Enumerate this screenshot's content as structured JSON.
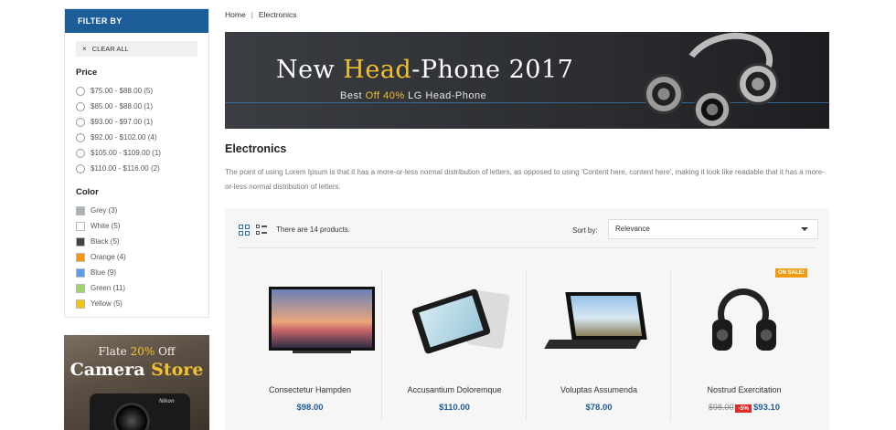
{
  "sidebar": {
    "filter_heading": "FILTER BY",
    "clear_all": "CLEAR ALL",
    "price_title": "Price",
    "prices": [
      "$75.00 - $88.00 (5)",
      "$85.00 - $88.00 (1)",
      "$93.00 - $97.00 (1)",
      "$92.00 - $102.00 (4)",
      "$105.00 - $109.00 (1)",
      "$110.00 - $116.00 (2)"
    ],
    "color_title": "Color",
    "colors": [
      {
        "label": "Grey (3)",
        "hex": "#aab0b8"
      },
      {
        "label": "White (5)",
        "hex": "#ffffff"
      },
      {
        "label": "Black (5)",
        "hex": "#434343"
      },
      {
        "label": "Orange (4)",
        "hex": "#f39c11"
      },
      {
        "label": "Blue (9)",
        "hex": "#5d9cec"
      },
      {
        "label": "Green (11)",
        "hex": "#a0d468"
      },
      {
        "label": "Yellow (5)",
        "hex": "#f1c40f"
      }
    ],
    "promo": {
      "pre": "Flate ",
      "pct": "20%",
      "post": " Off",
      "word1": "Camera ",
      "word2": "Store",
      "brand": "Nikon"
    }
  },
  "breadcrumb": {
    "home": "Home",
    "current": "Electronics"
  },
  "banner": {
    "title_a": "New ",
    "title_hl": "Head",
    "title_b": "-Phone 2017",
    "sub_a": "Best ",
    "sub_hl": "Off 40%",
    "sub_b": " LG Head-Phone"
  },
  "category": {
    "title": "Electronics",
    "description": "The point of using Lorem Ipsum is that it has a more-or-less normal distribution of letters, as opposed to using 'Content here, content here', making it look like readable that it has a more-or-less normal distribution of letters."
  },
  "toolbar": {
    "count": "There are 14 products.",
    "sort_label": "Sort by:",
    "sort_value": "Relevance"
  },
  "products": [
    {
      "name": "Consectetur Hampden",
      "price": "$98.00"
    },
    {
      "name": "Accusantium Doloremque",
      "price": "$110.00"
    },
    {
      "name": "Voluptas Assumenda",
      "price": "$78.00"
    },
    {
      "name": "Nostrud Exercitation",
      "old_price": "$98.00",
      "discount": "-5%",
      "price": "$93.10",
      "badge": "ON SALE!"
    }
  ],
  "colors": {
    "accent": "#1c5d97",
    "sale": "#f39c12",
    "discount": "#e02b27",
    "highlight": "#f2c12e"
  }
}
